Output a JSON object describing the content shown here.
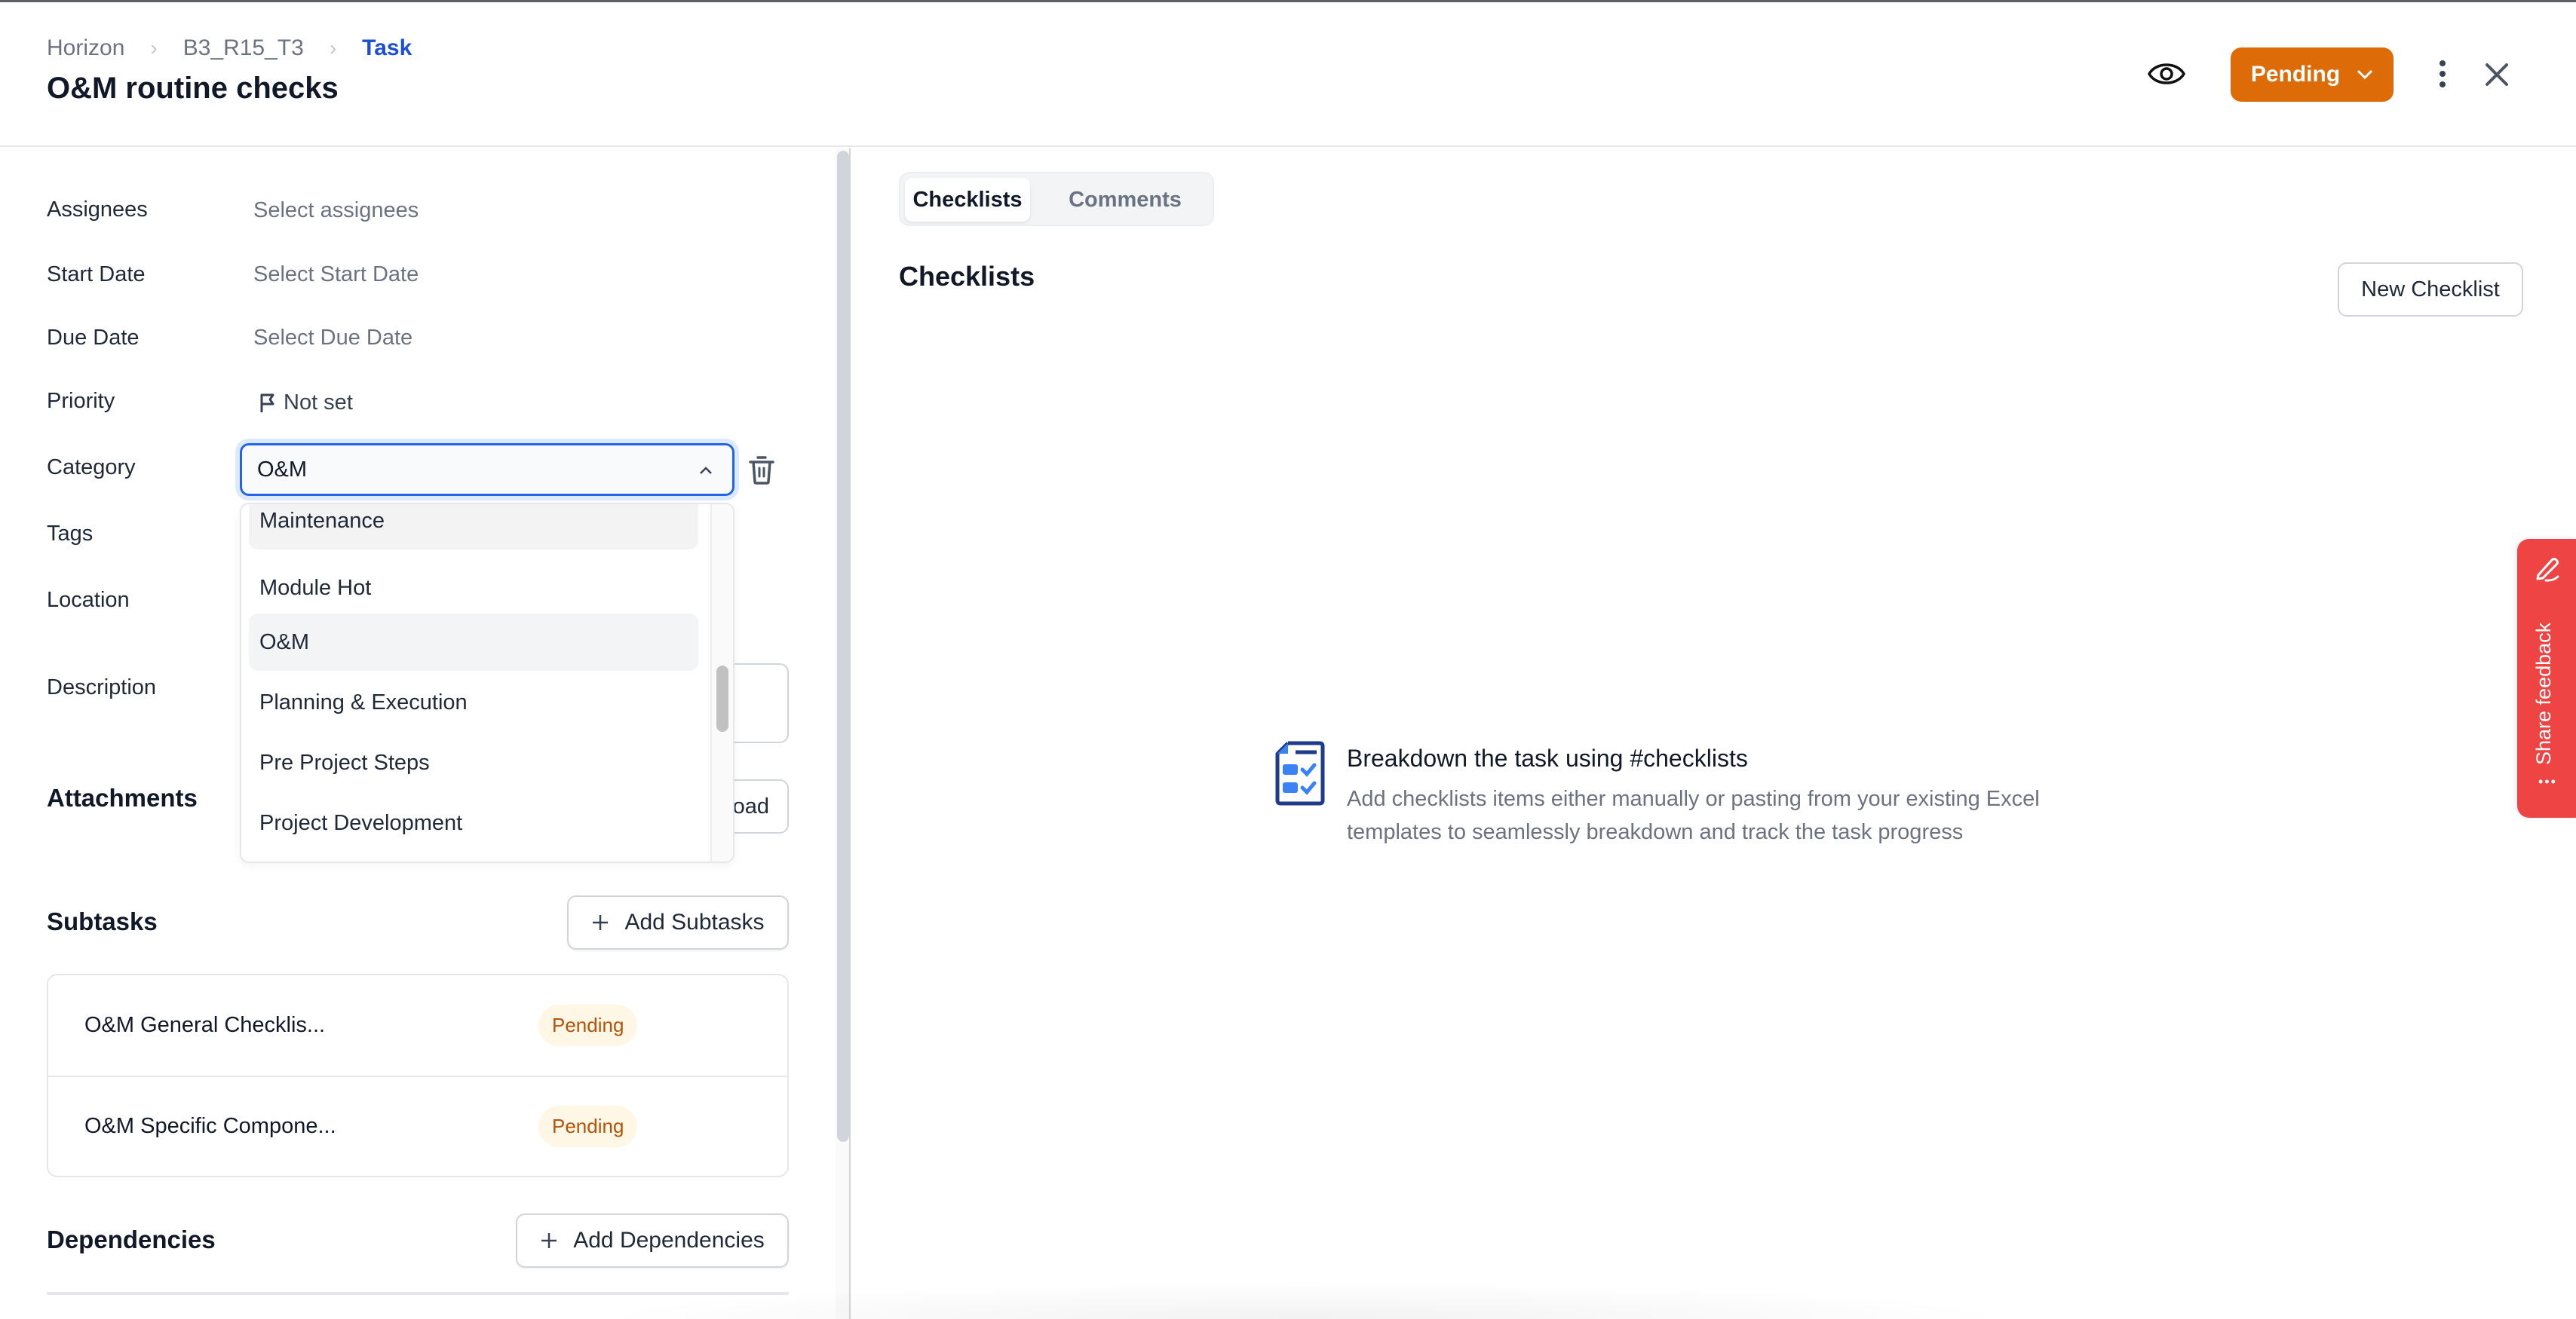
{
  "breadcrumb": [
    "Horizon",
    "B3_R15_T3",
    "Task"
  ],
  "title": "O&M routine checks",
  "header": {
    "watch_icon": "eye-icon",
    "status_label": "Pending",
    "status_color": "#dd6b08",
    "more_icon": "kebab-vertical-icon",
    "close_icon": "close-icon"
  },
  "fields": {
    "assignees": {
      "label": "Assignees",
      "placeholder": "Select assignees"
    },
    "start_date": {
      "label": "Start Date",
      "placeholder": "Select Start Date"
    },
    "due_date": {
      "label": "Due Date",
      "placeholder": "Select Due Date"
    },
    "priority": {
      "label": "Priority",
      "value": "Not set",
      "icon": "flag-icon"
    },
    "category": {
      "label": "Category",
      "value": "O&M"
    },
    "tags": {
      "label": "Tags"
    },
    "location": {
      "label": "Location"
    },
    "description": {
      "label": "Description"
    }
  },
  "category_dropdown": {
    "options": [
      "Maintenance",
      "Module Hot",
      "O&M",
      "Planning & Execution",
      "Pre Project Steps",
      "Project Development"
    ],
    "selected": "O&M",
    "hovered": "Maintenance"
  },
  "attachments": {
    "title": "Attachments",
    "upload_label": "Upload"
  },
  "subtasks": {
    "title": "Subtasks",
    "add_label": "Add Subtasks",
    "items": [
      {
        "name": "O&M General Checklis...",
        "status": "Pending"
      },
      {
        "name": "O&M Specific Compone...",
        "status": "Pending"
      }
    ]
  },
  "dependencies": {
    "title": "Dependencies",
    "add_label": "Add Dependencies"
  },
  "tabs": [
    {
      "label": "Checklists",
      "active": true
    },
    {
      "label": "Comments",
      "active": false
    }
  ],
  "checklists": {
    "title": "Checklists",
    "new_label": "New Checklist",
    "empty_title": "Breakdown the task using #checklists",
    "empty_desc": "Add checklists items either manually or pasting from your existing Excel templates to seamlessly breakdown and track the task progress"
  },
  "feedback": {
    "label": "Share feedback",
    "color": "#ef4444"
  }
}
